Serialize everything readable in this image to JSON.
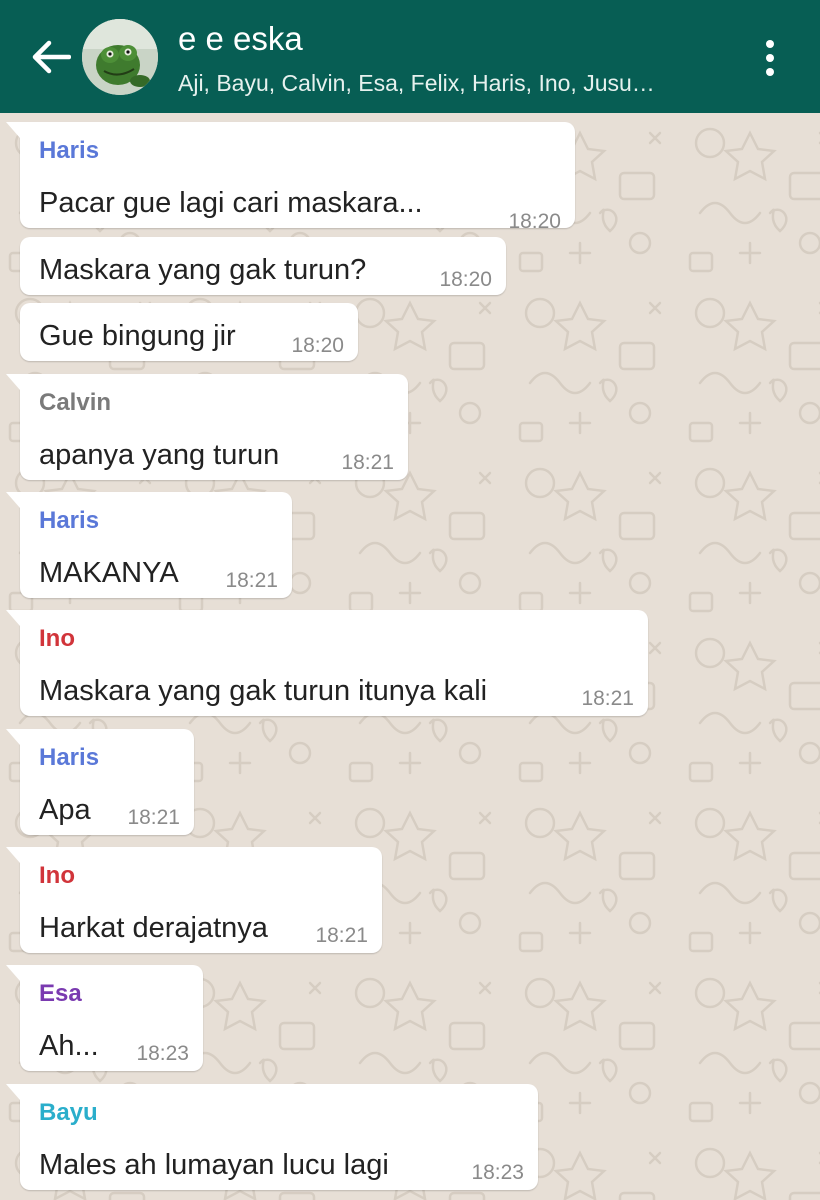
{
  "header": {
    "title": "e e eska",
    "subtitle": "Aji, Bayu, Calvin, Esa, Felix, Haris, Ino, Jusu…",
    "back_icon": "arrow-left-icon",
    "menu_icon": "more-vert-icon",
    "background": "#075e54"
  },
  "colors": {
    "Haris": "#5a78d8",
    "Calvin": "#7a7a7a",
    "Ino": "#d1343a",
    "Esa": "#7a3ab0",
    "Bayu": "#2aaecb"
  },
  "messages": [
    {
      "sender": "Haris",
      "text": "Pacar gue lagi cari maskara...",
      "time": "18:20"
    },
    {
      "sender": "",
      "text": "Maskara yang gak turun?",
      "time": "18:20"
    },
    {
      "sender": "",
      "text": "Gue bingung jir",
      "time": "18:20"
    },
    {
      "sender": "Calvin",
      "text": "apanya yang turun",
      "time": "18:21"
    },
    {
      "sender": "Haris",
      "text": "MAKANYA",
      "time": "18:21"
    },
    {
      "sender": "Ino",
      "text": "Maskara yang gak turun itunya kali",
      "time": "18:21"
    },
    {
      "sender": "Haris",
      "text": "Apa",
      "time": "18:21"
    },
    {
      "sender": "Ino",
      "text": "Harkat derajatnya",
      "time": "18:21"
    },
    {
      "sender": "Esa",
      "text": "Ah...",
      "time": "18:23"
    },
    {
      "sender": "Bayu",
      "text": "Males ah lumayan lucu lagi",
      "time": "18:23"
    }
  ]
}
